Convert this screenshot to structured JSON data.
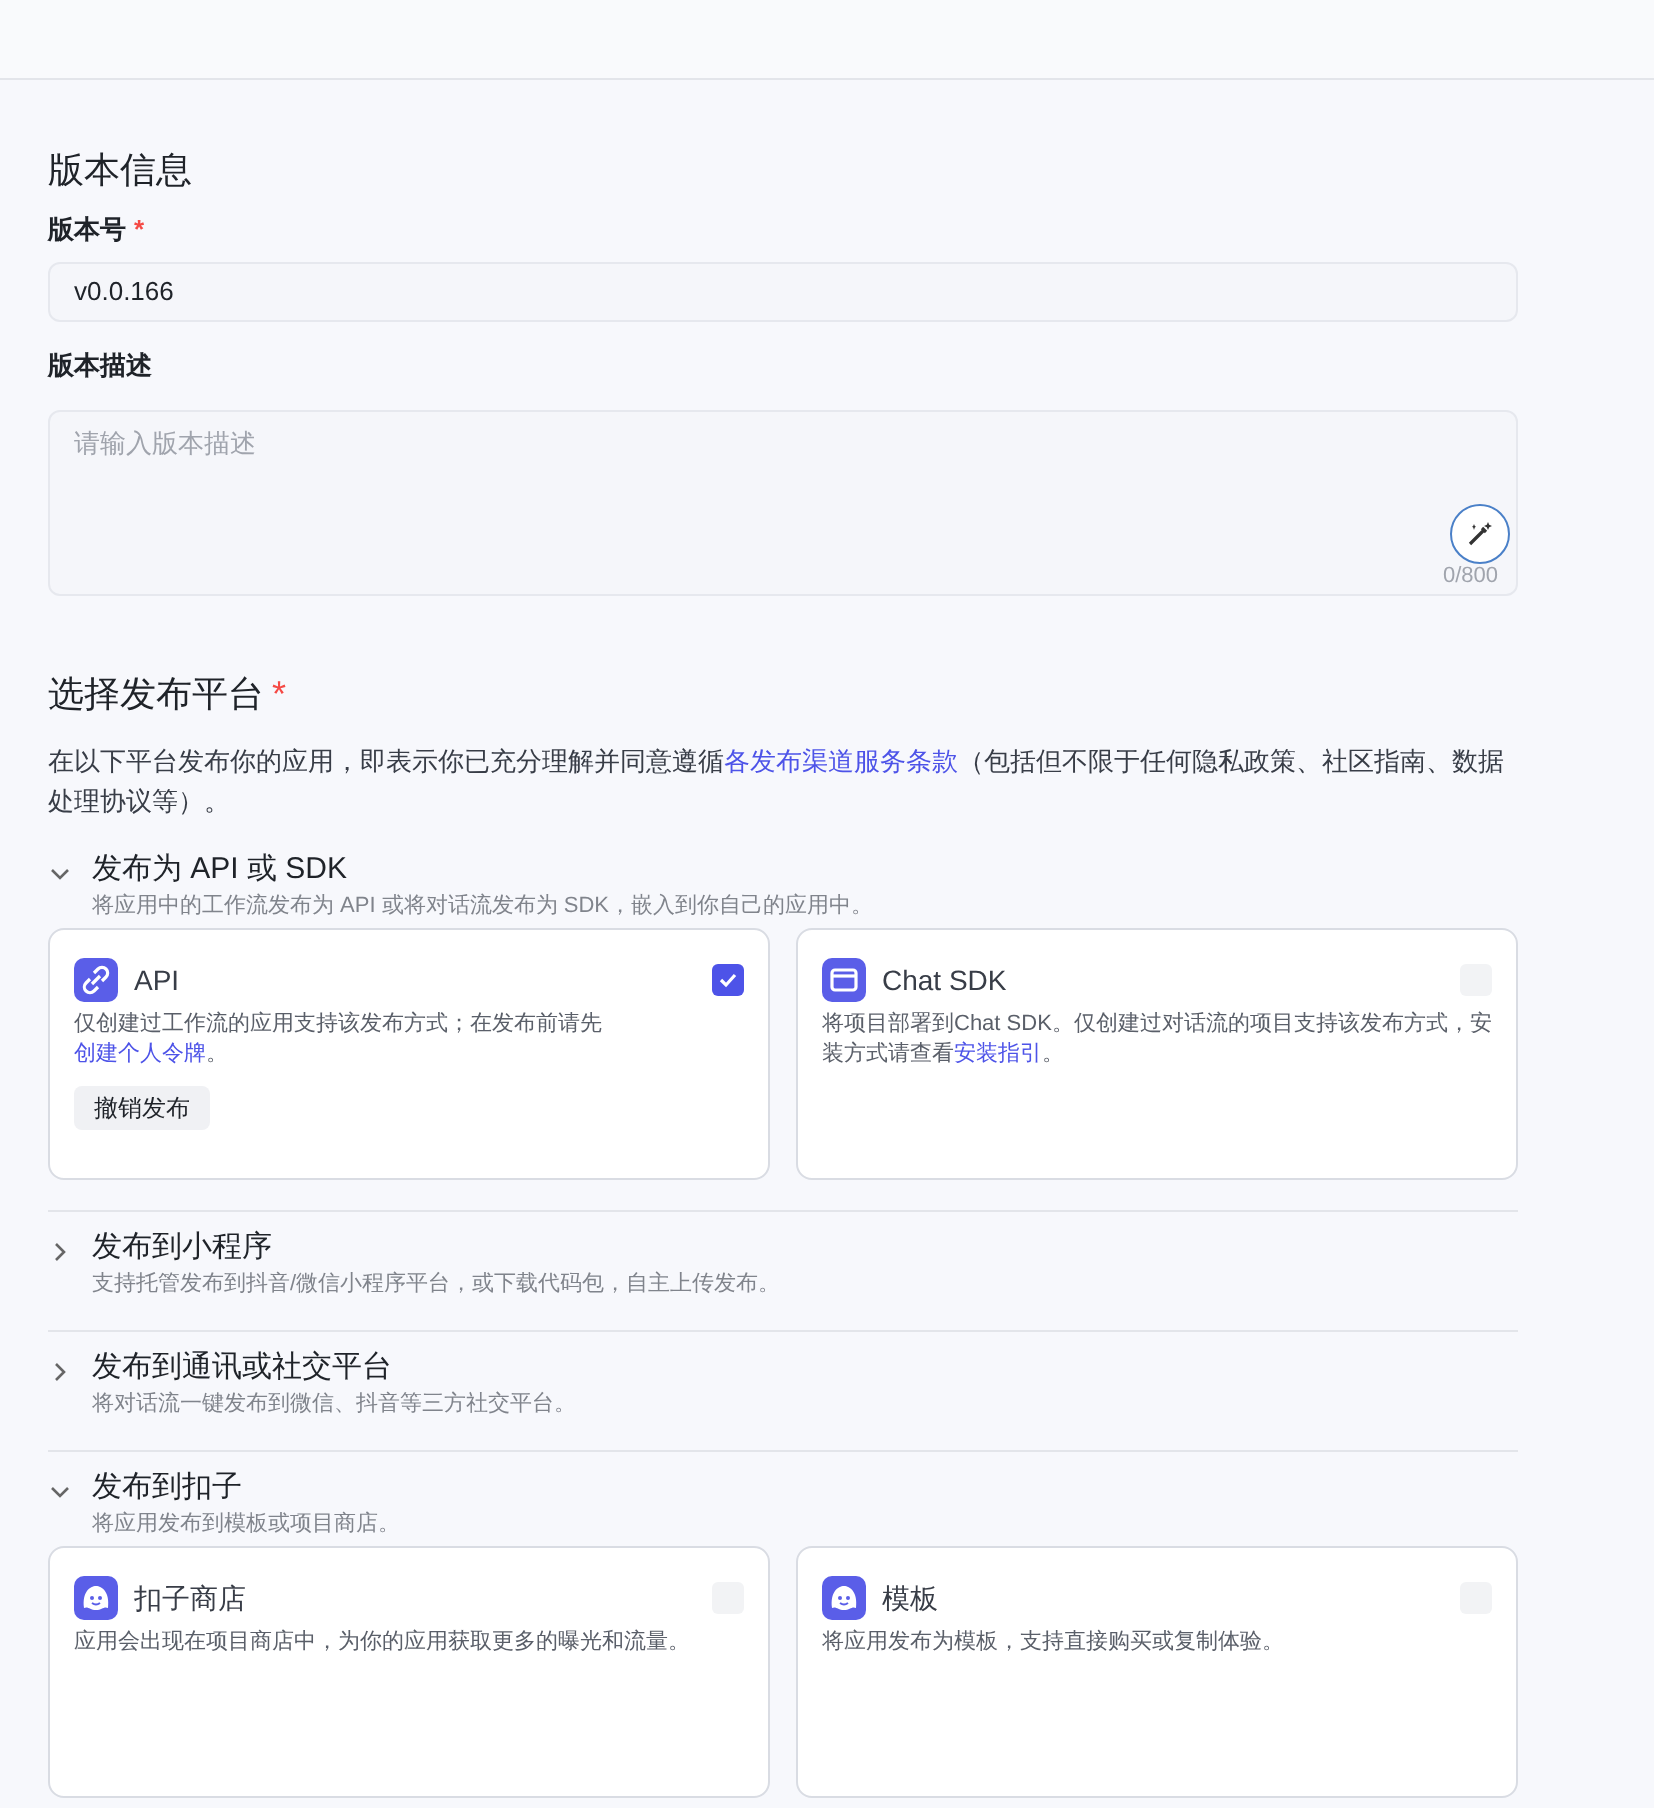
{
  "version_info": {
    "title": "版本信息",
    "version_label": "版本号",
    "version_required_mark": "*",
    "version_value": "v0.0.166",
    "description_label": "版本描述",
    "description_placeholder": "请输入版本描述",
    "counter": "0/800"
  },
  "platforms": {
    "title": "选择发布平台",
    "required_mark": "*",
    "notice_before": "在以下平台发布你的应用，即表示你已充分理解并同意遵循",
    "notice_link": "各发布渠道服务条款",
    "notice_after": "（包括但不限于任何隐私政策、社区指南、数据处理协议等）。",
    "groups": [
      {
        "title": "发布为 API 或 SDK",
        "description": "将应用中的工作流发布为 API 或将对话流发布为 SDK，嵌入到你自己的应用中。",
        "expanded": true,
        "cards": [
          {
            "kind": "link",
            "title": "API",
            "description": "仅创建过工作流的应用支持该发布方式；在发布前请先",
            "link": "创建个人令牌",
            "description_after": "。",
            "checked": true,
            "action": "撤销发布"
          },
          {
            "kind": "window",
            "title": "Chat SDK",
            "description": "将项目部署到Chat SDK。仅创建过对话流的项目支持该发布方式，安装方式请查看",
            "link": "安装指引",
            "description_after": "。",
            "checked": false
          }
        ]
      },
      {
        "title": "发布到小程序",
        "description": "支持托管发布到抖音/微信小程序平台，或下载代码包，自主上传发布。",
        "expanded": false
      },
      {
        "title": "发布到通讯或社交平台",
        "description": "将对话流一键发布到微信、抖音等三方社交平台。",
        "expanded": false
      },
      {
        "title": "发布到扣子",
        "description": "将应用发布到模板或项目商店。",
        "expanded": true,
        "cards": [
          {
            "kind": "mascot",
            "title": "扣子商店",
            "description": "应用会出现在项目商店中，为你的应用获取更多的曝光和流量。",
            "checked": false
          },
          {
            "kind": "mascot",
            "title": "模板",
            "description": "将应用发布为模板，支持直接购买或复制体验。",
            "checked": false
          }
        ]
      }
    ]
  }
}
